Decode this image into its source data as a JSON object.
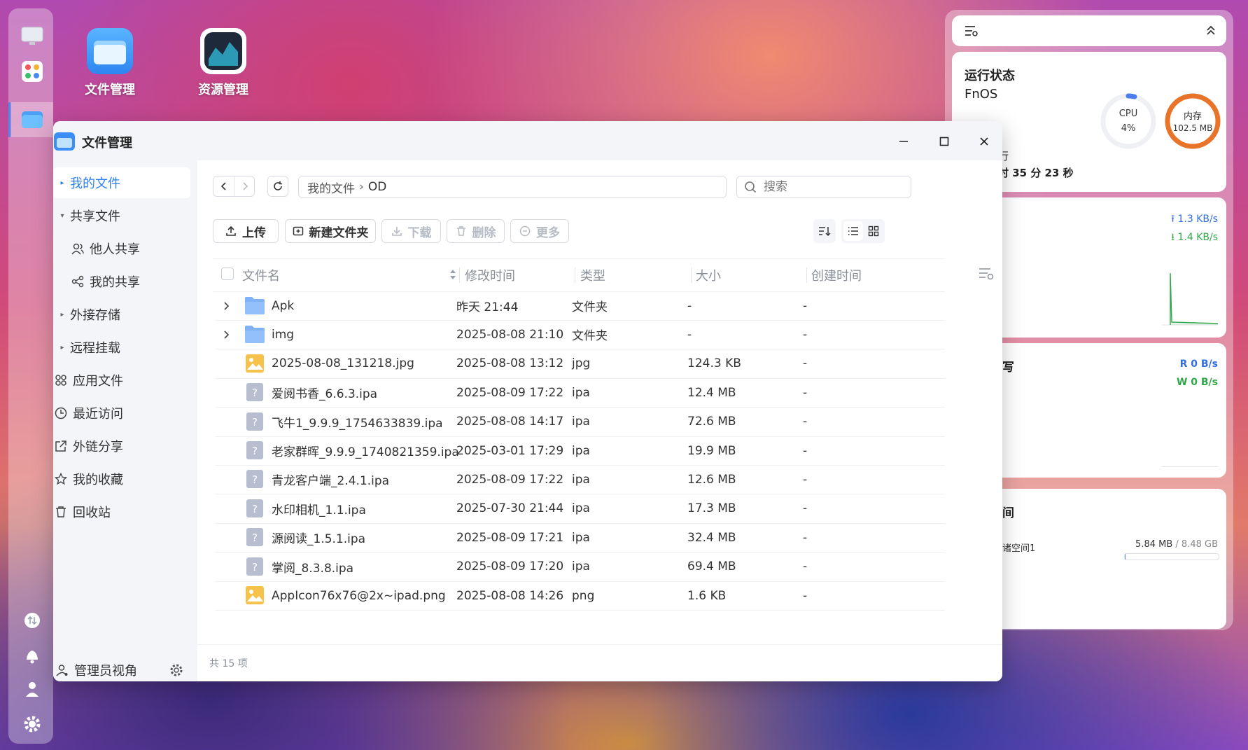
{
  "desktop": {
    "icons": [
      {
        "label": "文件管理"
      },
      {
        "label": "资源管理"
      }
    ]
  },
  "widget": {
    "status_title": "运行状态",
    "os_name": "FnOS",
    "uptime_fragment": "行",
    "uptime": "时 35 分 23 秒",
    "cpu_label": "CPU",
    "cpu_value": "4%",
    "cpu_percent": 4,
    "mem_label": "内存",
    "mem_value": "102.5 MB",
    "net_up": "1.3 KB/s",
    "net_down": "1.4 KB/s",
    "disk_title_fragment": "写",
    "disk_read": "R  0 B/s",
    "disk_write": "W  0 B/s",
    "storage_title_fragment": "间",
    "storage_name_fragment": "诸空间1",
    "storage_used": "5.84 MB",
    "storage_sep": " / ",
    "storage_total": "8.48 GB",
    "storage_fraction": 0.001,
    "colors": {
      "cpu": "#4a7ef0",
      "mem": "#e8742a",
      "up": "#2f6fe0",
      "down": "#2fa84a"
    }
  },
  "window": {
    "title": "文件管理",
    "sidebar": {
      "items": [
        {
          "label": "我的文件",
          "arrow": "▸"
        },
        {
          "label": "共享文件",
          "arrow": "▾"
        },
        {
          "label": "他人共享",
          "arrow": ""
        },
        {
          "label": "我的共享",
          "arrow": ""
        },
        {
          "label": "外接存储",
          "arrow": "▸"
        },
        {
          "label": "远程挂载",
          "arrow": "▸"
        },
        {
          "label": "应用文件",
          "arrow": ""
        },
        {
          "label": "最近访问",
          "arrow": ""
        },
        {
          "label": "外链分享",
          "arrow": ""
        },
        {
          "label": "我的收藏",
          "arrow": ""
        },
        {
          "label": "回收站",
          "arrow": ""
        }
      ],
      "admin_label": "管理员视角"
    },
    "path": {
      "root": "我的文件",
      "sep": "›",
      "current": "OD"
    },
    "search_placeholder": "搜索",
    "toolbar": {
      "upload": "上传",
      "new_folder": "新建文件夹",
      "download": "下载",
      "delete": "删除",
      "more": "更多"
    },
    "columns": {
      "name": "文件名",
      "modified": "修改时间",
      "type": "类型",
      "size": "大小",
      "created": "创建时间"
    },
    "rows": [
      {
        "name": "Apk",
        "modified": "昨天 21:44",
        "type": "文件夹",
        "size": "-",
        "created": "-"
      },
      {
        "name": "img",
        "modified": "2025-08-08 21:10",
        "type": "文件夹",
        "size": "-",
        "created": "-"
      },
      {
        "name": "2025-08-08_131218.jpg",
        "modified": "2025-08-08 13:12",
        "type": "jpg",
        "size": "124.3 KB",
        "created": "-"
      },
      {
        "name": "爱阅书香_6.6.3.ipa",
        "modified": "2025-08-09 17:22",
        "type": "ipa",
        "size": "12.4 MB",
        "created": "-"
      },
      {
        "name": "飞牛1_9.9.9_1754633839.ipa",
        "modified": "2025-08-08 14:17",
        "type": "ipa",
        "size": "72.6 MB",
        "created": "-"
      },
      {
        "name": "老家群晖_9.9.9_1740821359.ipa",
        "modified": "2025-03-01 17:29",
        "type": "ipa",
        "size": "19.9 MB",
        "created": "-"
      },
      {
        "name": "青龙客户端_2.4.1.ipa",
        "modified": "2025-08-09 17:22",
        "type": "ipa",
        "size": "12.6 MB",
        "created": "-"
      },
      {
        "name": "水印相机_1.1.ipa",
        "modified": "2025-07-30 21:44",
        "type": "ipa",
        "size": "17.3 MB",
        "created": "-"
      },
      {
        "name": "源阅读_1.5.1.ipa",
        "modified": "2025-08-09 17:21",
        "type": "ipa",
        "size": "32.4 MB",
        "created": "-"
      },
      {
        "name": "掌阅_8.3.8.ipa",
        "modified": "2025-08-09 17:20",
        "type": "ipa",
        "size": "69.4 MB",
        "created": "-"
      },
      {
        "name": "AppIcon76x76@2x~ipad.png",
        "modified": "2025-08-08 14:26",
        "type": "png",
        "size": "1.6 KB",
        "created": "-"
      }
    ],
    "row_kinds": [
      "folder",
      "folder",
      "image",
      "unknown",
      "unknown",
      "unknown",
      "unknown",
      "unknown",
      "unknown",
      "unknown",
      "image"
    ],
    "footer_count": "共 15 项"
  }
}
